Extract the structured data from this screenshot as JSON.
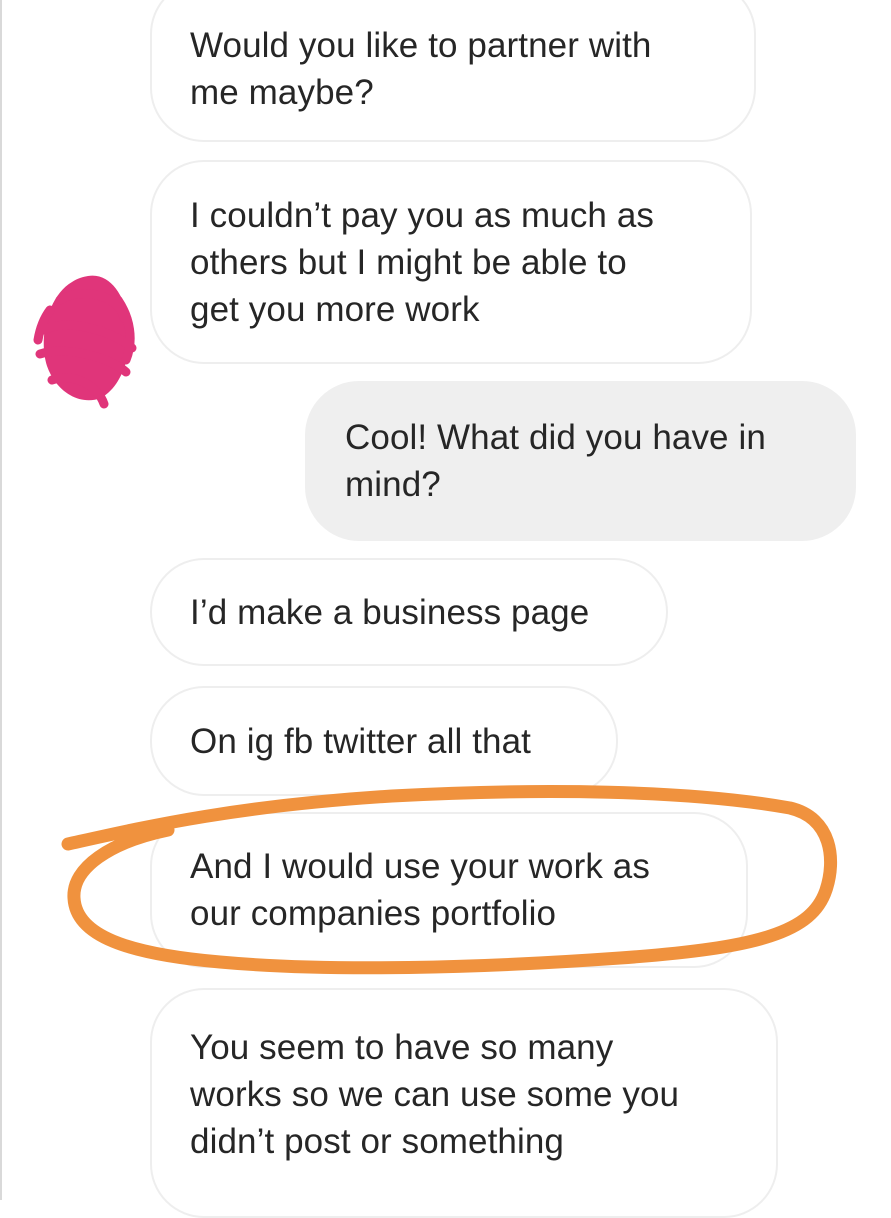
{
  "conversation": {
    "messages": [
      {
        "sender": "them",
        "text": "Would you like to partner with\nme maybe?"
      },
      {
        "sender": "them",
        "text": "I couldn’t pay you as much as\nothers but I might be able to\nget you more work"
      },
      {
        "sender": "me",
        "text": "Cool! What did you have in\nmind?"
      },
      {
        "sender": "them",
        "text": "I’d make a business page"
      },
      {
        "sender": "them",
        "text": "On ig fb twitter all that"
      },
      {
        "sender": "them",
        "text": "And I would use your work as\nour companies portfolio"
      },
      {
        "sender": "them",
        "text": "You seem to have so many\nworks so we can use some you\ndidn’t post or something"
      }
    ]
  },
  "annotations": {
    "avatar_scribble_color": "#e0357a",
    "highlight_circle_color": "#f0923e",
    "highlighted_message_index": 5
  },
  "colors": {
    "received_bubble_border": "#eeeeee",
    "sent_bubble_background": "#efefef",
    "text": "#262626"
  }
}
